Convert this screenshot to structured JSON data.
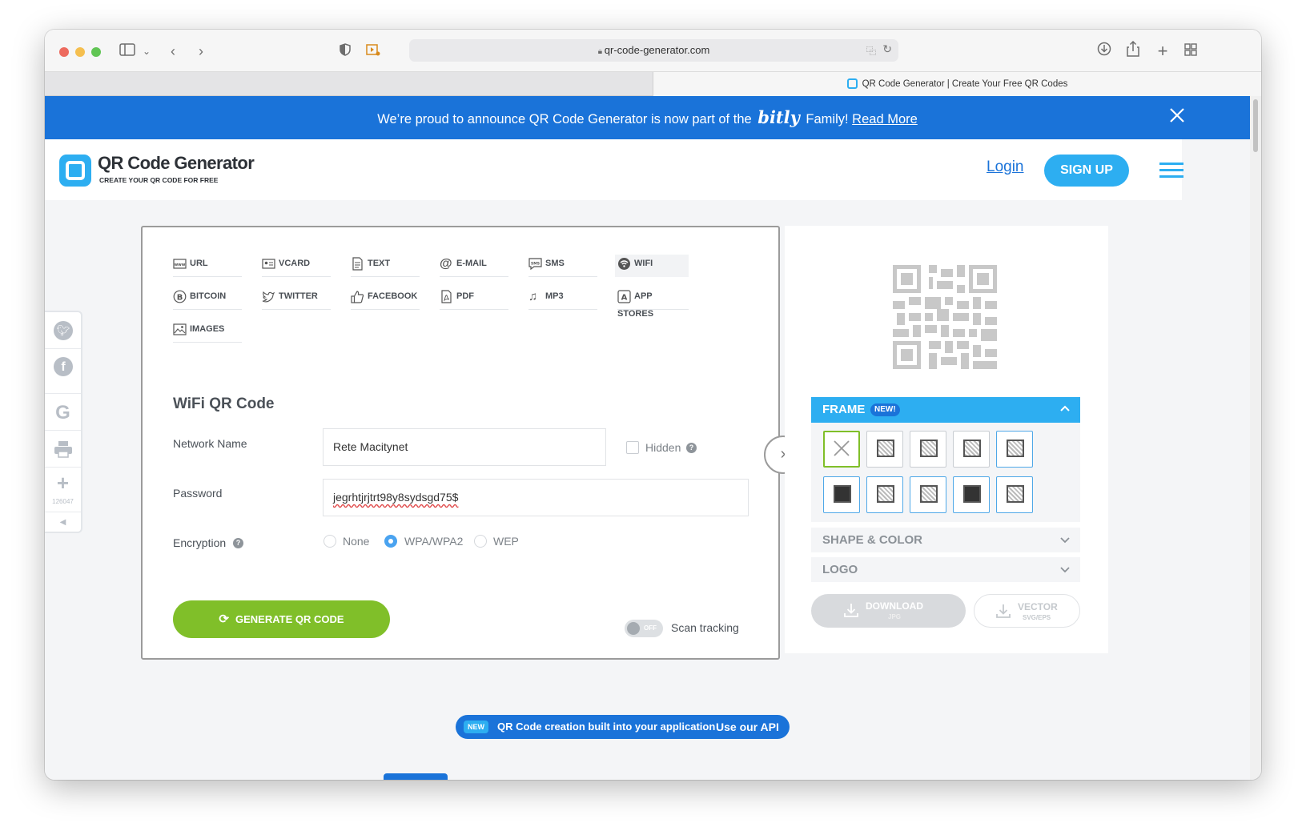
{
  "browser": {
    "url": "qr-code-generator.com",
    "tab_title": "QR Code Generator | Create Your Free QR Codes"
  },
  "banner": {
    "text_before": "We’re proud to announce QR Code Generator is now part of the",
    "brand": "bitly",
    "text_after": "Family!",
    "link": "Read More"
  },
  "header": {
    "logo_title": "QR Code Generator",
    "logo_subtitle": "CREATE YOUR QR CODE FOR FREE",
    "login": "Login",
    "signup": "SIGN UP"
  },
  "share": {
    "count": "126047"
  },
  "types": [
    {
      "label": "URL",
      "icon": "url-icon"
    },
    {
      "label": "VCARD",
      "icon": "vcard-icon"
    },
    {
      "label": "TEXT",
      "icon": "text-icon"
    },
    {
      "label": "E-MAIL",
      "icon": "email-icon"
    },
    {
      "label": "SMS",
      "icon": "sms-icon"
    },
    {
      "label": "WIFI",
      "icon": "wifi-icon",
      "active": true
    },
    {
      "label": "BITCOIN",
      "icon": "bitcoin-icon"
    },
    {
      "label": "TWITTER",
      "icon": "twitter-icon"
    },
    {
      "label": "FACEBOOK",
      "icon": "facebook-icon"
    },
    {
      "label": "PDF",
      "icon": "pdf-icon"
    },
    {
      "label": "MP3",
      "icon": "mp3-icon"
    },
    {
      "label": "APP STORES",
      "icon": "app-stores-icon"
    },
    {
      "label": "IMAGES",
      "icon": "images-icon"
    }
  ],
  "form": {
    "title": "WiFi QR Code",
    "network_label": "Network Name",
    "network_value": "Rete Macitynet",
    "hidden_label": "Hidden",
    "password_label": "Password",
    "password_value": "jegrhtjrjtrt98y8sydsgd75$",
    "encryption_label": "Encryption",
    "encryption_options": [
      "None",
      "WPA/WPA2",
      "WEP"
    ],
    "encryption_selected": "WPA/WPA2",
    "generate_label": "GENERATE QR CODE",
    "toggle_label": "OFF",
    "scan_tracking_label": "Scan tracking"
  },
  "panel": {
    "frame_label": "FRAME",
    "frame_badge": "NEW!",
    "shape_color_label": "SHAPE & COLOR",
    "logo_label": "LOGO",
    "download_label": "DOWNLOAD",
    "download_sub": "JPG",
    "vector_label": "VECTOR",
    "vector_sub": "SVG/EPS"
  },
  "api": {
    "badge": "NEW",
    "text": "QR Code creation built into your application",
    "link": "Use our API"
  },
  "colors": {
    "brand_blue": "#1a73d9",
    "cyan": "#2daef1",
    "green": "#80bf29"
  }
}
